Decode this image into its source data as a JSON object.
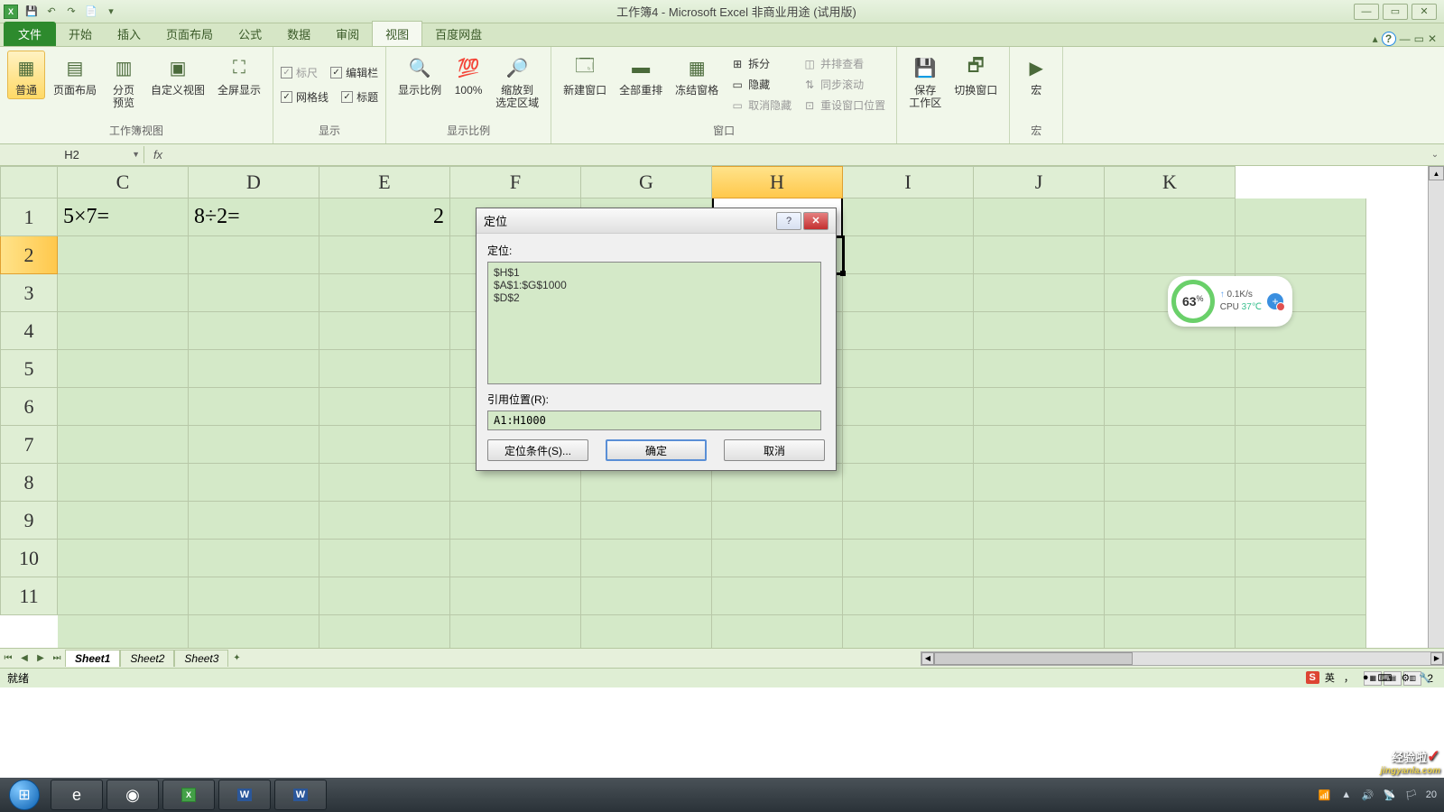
{
  "app": {
    "title": "工作簿4 - Microsoft Excel 非商业用途 (试用版)"
  },
  "qat": {
    "save": "💾",
    "undo": "↶",
    "redo": "↷",
    "doc": "📄"
  },
  "tabs": {
    "file": "文件",
    "home": "开始",
    "insert": "插入",
    "layout": "页面布局",
    "formula": "公式",
    "data": "数据",
    "review": "审阅",
    "view": "视图",
    "baidu": "百度网盘"
  },
  "ribbon": {
    "g1": {
      "normal": "普通",
      "page_layout": "页面布局",
      "page_break": "分页\n预览",
      "custom": "自定义视图",
      "fullscreen": "全屏显示",
      "label": "工作簿视图"
    },
    "g2": {
      "ruler": "标尺",
      "formula_bar": "编辑栏",
      "gridlines": "网格线",
      "headings": "标题",
      "label": "显示"
    },
    "g3": {
      "zoom": "显示比例",
      "zoom100": "100%",
      "zoom_sel": "缩放到\n选定区域",
      "label": "显示比例"
    },
    "g4": {
      "new_win": "新建窗口",
      "arrange": "全部重排",
      "freeze": "冻结窗格",
      "split": "拆分",
      "hide": "隐藏",
      "unhide": "取消隐藏",
      "side": "并排查看",
      "sync": "同步滚动",
      "reset": "重设窗口位置",
      "label": "窗口"
    },
    "g5": {
      "workspace": "保存\n工作区",
      "switch": "切换窗口",
      "label": ""
    },
    "g6": {
      "macro": "宏",
      "label": "宏"
    }
  },
  "namebox": "H2",
  "columns": [
    "C",
    "D",
    "E",
    "F",
    "G",
    "H",
    "I",
    "J",
    "K"
  ],
  "rows": [
    "1",
    "2",
    "3",
    "4",
    "5",
    "6",
    "7",
    "8",
    "9",
    "10",
    "11"
  ],
  "cell_data": {
    "C1": "5×7=",
    "D1": "8÷2=",
    "E1": "2"
  },
  "dialog": {
    "title": "定位",
    "goto_label": "定位:",
    "list": [
      "$H$1",
      "$A$1:$G$1000",
      "$D$2"
    ],
    "ref_label": "引用位置(R):",
    "ref_value": "A1:H1000",
    "special": "定位条件(S)...",
    "ok": "确定",
    "cancel": "取消"
  },
  "sheets": {
    "s1": "Sheet1",
    "s2": "Sheet2",
    "s3": "Sheet3"
  },
  "status": {
    "ready": "就绪",
    "zoom": "2"
  },
  "sysmon": {
    "pct": "63",
    "net": "0.1K/s",
    "cpu": "CPU",
    "temp": "37℃"
  },
  "ime": {
    "s": "S",
    "lang": "英",
    "punct": "，",
    "full": "●"
  },
  "watermark": {
    "main": "经验啦",
    "sub": "jingyanla.com"
  },
  "taskbar_time": "20"
}
